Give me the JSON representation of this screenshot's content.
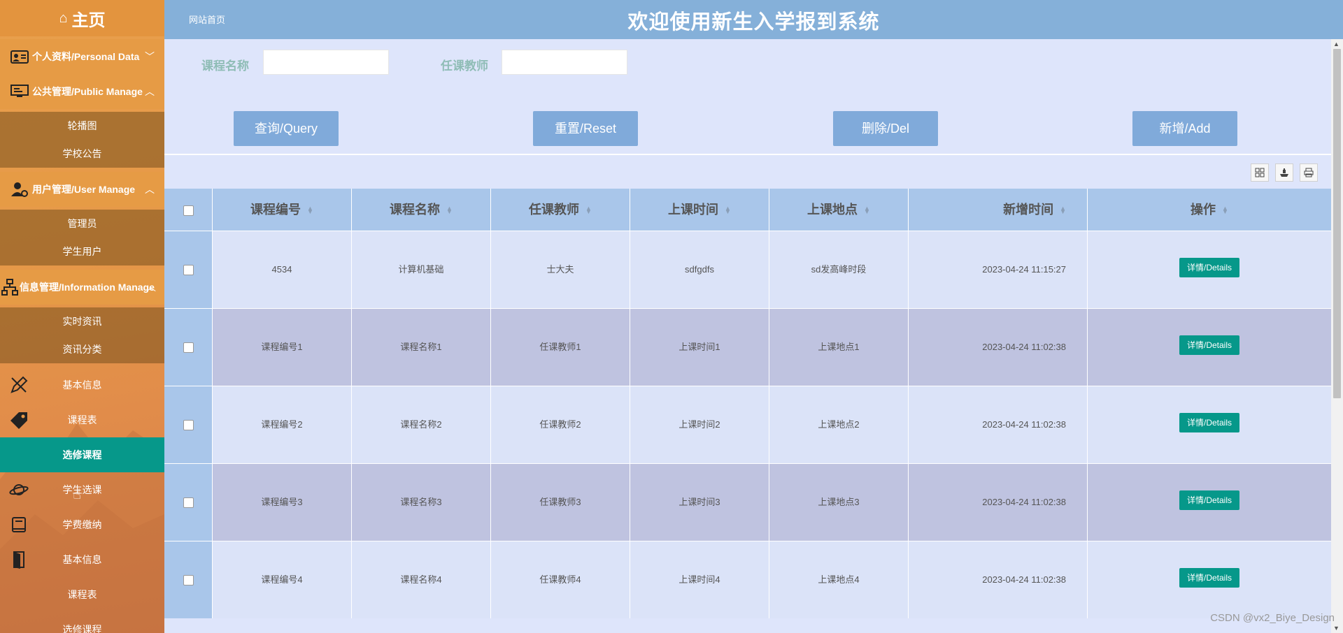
{
  "sidebar": {
    "home": "主页",
    "personal": "个人资料/Personal Data",
    "public_manage": "公共管理/Public Manage",
    "public_items": [
      "轮播图",
      "学校公告"
    ],
    "user_manage": "用户管理/User Manage",
    "user_items": [
      "管理员",
      "学生用户"
    ],
    "info_manage": "信息管理/Information Manage",
    "info_items": [
      "实时资讯",
      "资讯分类"
    ],
    "flat_items": [
      "基本信息",
      "课程表",
      "选修课程",
      "学生选课",
      "学费缴纳",
      "基本信息",
      "课程表",
      "选修课程"
    ],
    "active_item": "选修课程"
  },
  "header": {
    "breadcrumb": "网站首页",
    "title": "欢迎使用新生入学报到系统"
  },
  "search": {
    "course_name_label": "课程名称",
    "teacher_label": "任课教师",
    "course_name_value": "",
    "teacher_value": ""
  },
  "buttons": {
    "query": "查询/Query",
    "reset": "重置/Reset",
    "delete": "删除/Del",
    "add": "新增/Add"
  },
  "table": {
    "columns": [
      "课程编号",
      "课程名称",
      "任课教师",
      "上课时间",
      "上课地点",
      "新增时间",
      "操作"
    ],
    "detail_label": "详情/Details",
    "rows": [
      [
        "4534",
        "计算机基础",
        "士大夫",
        "sdfgdfs",
        "sd发高峰时段",
        "2023-04-24 11:15:27"
      ],
      [
        "课程编号1",
        "课程名称1",
        "任课教师1",
        "上课时间1",
        "上课地点1",
        "2023-04-24 11:02:38"
      ],
      [
        "课程编号2",
        "课程名称2",
        "任课教师2",
        "上课时间2",
        "上课地点2",
        "2023-04-24 11:02:38"
      ],
      [
        "课程编号3",
        "课程名称3",
        "任课教师3",
        "上课时间3",
        "上课地点3",
        "2023-04-24 11:02:38"
      ],
      [
        "课程编号4",
        "课程名称4",
        "任课教师4",
        "上课时间4",
        "上课地点4",
        "2023-04-24 11:02:38"
      ]
    ]
  },
  "watermark": "CSDN @vx2_Biye_Design",
  "colors": {
    "sidebar": "#e69b45",
    "active": "#06988a",
    "header": "#85b0d9",
    "main_bg": "#dee5fb",
    "button": "#80aada",
    "table_head": "#a9c6ea"
  }
}
